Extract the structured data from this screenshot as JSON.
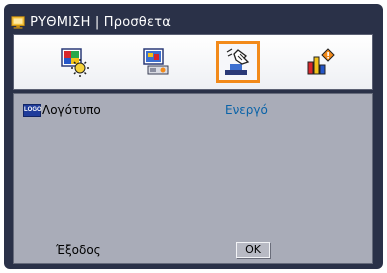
{
  "window": {
    "title": "ΡΥΘΜΙΣΗ | Προσθετα",
    "icon": "monitor-menu-icon"
  },
  "tabs": [
    {
      "icon": "image-settings-icon",
      "selected": false
    },
    {
      "icon": "display-settings-icon",
      "selected": false
    },
    {
      "icon": "setup-hand-icon",
      "selected": true
    },
    {
      "icon": "info-chart-icon",
      "selected": false
    }
  ],
  "settings": [
    {
      "badge": "LOGO",
      "label": "Λογότυπο",
      "value": "Ενεργό"
    }
  ],
  "footer": {
    "exit_label": "Έξοδος",
    "ok_label": "OK"
  },
  "colors": {
    "frame": "#2a3148",
    "selected_tab_border": "#f28a1a",
    "value_text": "#0a63a8",
    "panel": "#a9acb8"
  }
}
